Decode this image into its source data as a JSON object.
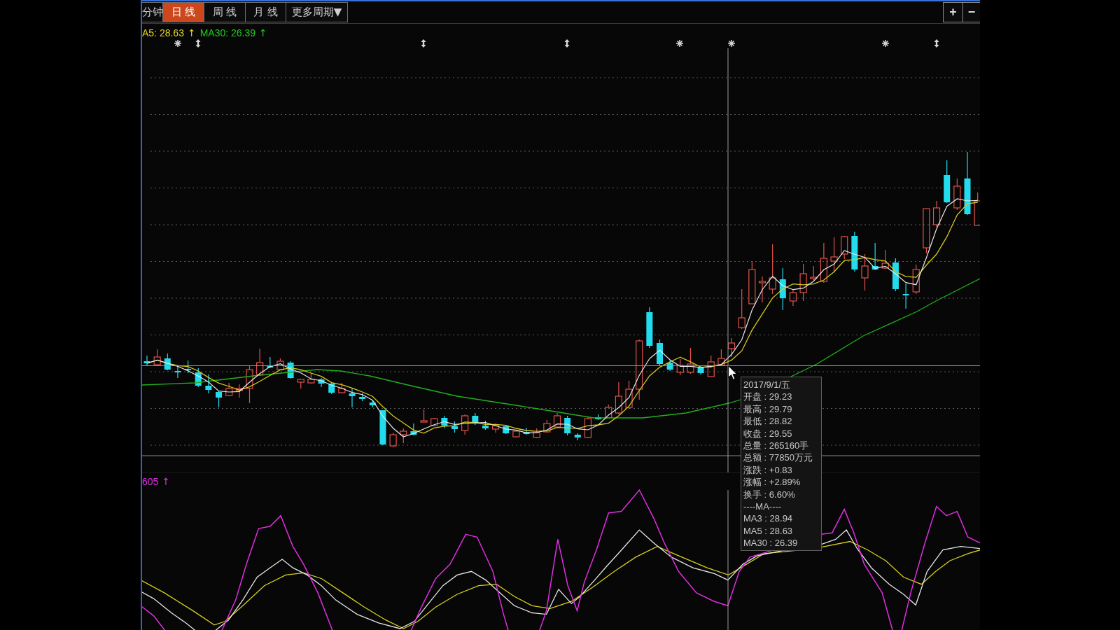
{
  "period_tabs": [
    {
      "label": "分钟",
      "selected": false
    },
    {
      "label": "日 线",
      "selected": true
    },
    {
      "label": "周 线",
      "selected": false
    },
    {
      "label": "月 线",
      "selected": false
    },
    {
      "label": "更多周期▼",
      "selected": false
    }
  ],
  "zoom_buttons": [
    {
      "label": "+"
    },
    {
      "label": "−"
    }
  ],
  "ma_legend": [
    {
      "text": "A5: 28.63",
      "arrow": "↑",
      "color": "#e6d41e"
    },
    {
      "text": "MA30: 26.39",
      "arrow": "↑",
      "color": "#22c81e"
    }
  ],
  "indicator_legend": {
    "text": "605",
    "arrow": "↑"
  },
  "tooltip": {
    "date": "2017/9/1/五",
    "rows": [
      "开盘 : 29.23",
      "最高 : 29.79",
      "最低 : 28.82",
      "收盘 : 29.55",
      "总量 : 265160手",
      "总额 : 77850万元",
      "涨跌 : +0.83",
      "涨幅 : +2.89%",
      "换手 : 6.60%",
      "----MA----",
      "MA3 : 28.94",
      "MA5 : 28.63",
      "MA30 : 26.39"
    ]
  }
}
